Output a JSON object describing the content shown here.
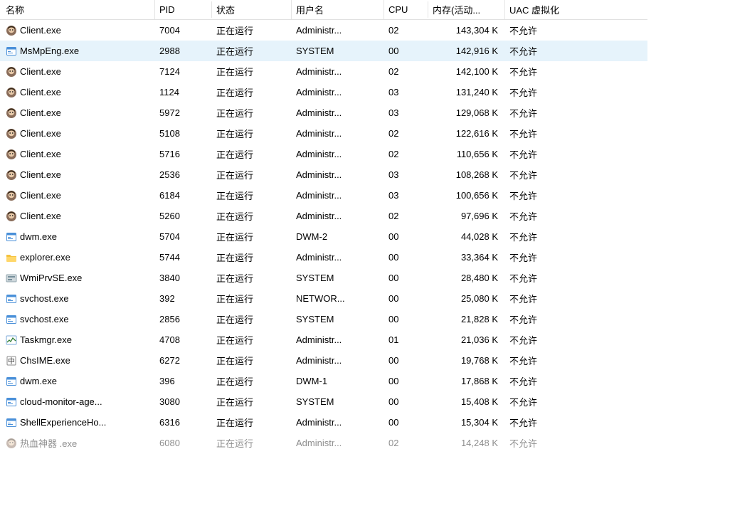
{
  "columns": {
    "name": "名称",
    "pid": "PID",
    "status": "状态",
    "user": "用户名",
    "cpu": "CPU",
    "memory": "内存(活动...",
    "uac": "UAC 虚拟化"
  },
  "status_running": "正在运行",
  "uac_not_allowed": "不允许",
  "rows": [
    {
      "icon": "client",
      "name": "Client.exe",
      "pid": "7004",
      "user": "Administr...",
      "cpu": "02",
      "mem": "143,304 K",
      "selected": false
    },
    {
      "icon": "generic",
      "name": "MsMpEng.exe",
      "pid": "2988",
      "user": "SYSTEM",
      "cpu": "00",
      "mem": "142,916 K",
      "selected": true
    },
    {
      "icon": "client",
      "name": "Client.exe",
      "pid": "7124",
      "user": "Administr...",
      "cpu": "02",
      "mem": "142,100 K",
      "selected": false
    },
    {
      "icon": "client",
      "name": "Client.exe",
      "pid": "1124",
      "user": "Administr...",
      "cpu": "03",
      "mem": "131,240 K",
      "selected": false
    },
    {
      "icon": "client",
      "name": "Client.exe",
      "pid": "5972",
      "user": "Administr...",
      "cpu": "03",
      "mem": "129,068 K",
      "selected": false
    },
    {
      "icon": "client",
      "name": "Client.exe",
      "pid": "5108",
      "user": "Administr...",
      "cpu": "02",
      "mem": "122,616 K",
      "selected": false
    },
    {
      "icon": "client",
      "name": "Client.exe",
      "pid": "5716",
      "user": "Administr...",
      "cpu": "02",
      "mem": "110,656 K",
      "selected": false
    },
    {
      "icon": "client",
      "name": "Client.exe",
      "pid": "2536",
      "user": "Administr...",
      "cpu": "03",
      "mem": "108,268 K",
      "selected": false
    },
    {
      "icon": "client",
      "name": "Client.exe",
      "pid": "6184",
      "user": "Administr...",
      "cpu": "03",
      "mem": "100,656 K",
      "selected": false
    },
    {
      "icon": "client",
      "name": "Client.exe",
      "pid": "5260",
      "user": "Administr...",
      "cpu": "02",
      "mem": "97,696 K",
      "selected": false
    },
    {
      "icon": "generic",
      "name": "dwm.exe",
      "pid": "5704",
      "user": "DWM-2",
      "cpu": "00",
      "mem": "44,028 K",
      "selected": false
    },
    {
      "icon": "folder",
      "name": "explorer.exe",
      "pid": "5744",
      "user": "Administr...",
      "cpu": "00",
      "mem": "33,364 K",
      "selected": false
    },
    {
      "icon": "wmi",
      "name": "WmiPrvSE.exe",
      "pid": "3840",
      "user": "SYSTEM",
      "cpu": "00",
      "mem": "28,480 K",
      "selected": false
    },
    {
      "icon": "generic",
      "name": "svchost.exe",
      "pid": "392",
      "user": "NETWOR...",
      "cpu": "00",
      "mem": "25,080 K",
      "selected": false
    },
    {
      "icon": "generic",
      "name": "svchost.exe",
      "pid": "2856",
      "user": "SYSTEM",
      "cpu": "00",
      "mem": "21,828 K",
      "selected": false
    },
    {
      "icon": "taskmgr",
      "name": "Taskmgr.exe",
      "pid": "4708",
      "user": "Administr...",
      "cpu": "01",
      "mem": "21,036 K",
      "selected": false
    },
    {
      "icon": "ime",
      "name": "ChsIME.exe",
      "pid": "6272",
      "user": "Administr...",
      "cpu": "00",
      "mem": "19,768 K",
      "selected": false
    },
    {
      "icon": "generic",
      "name": "dwm.exe",
      "pid": "396",
      "user": "DWM-1",
      "cpu": "00",
      "mem": "17,868 K",
      "selected": false
    },
    {
      "icon": "generic",
      "name": "cloud-monitor-age...",
      "pid": "3080",
      "user": "SYSTEM",
      "cpu": "00",
      "mem": "15,408 K",
      "selected": false
    },
    {
      "icon": "generic",
      "name": "ShellExperienceHo...",
      "pid": "6316",
      "user": "Administr...",
      "cpu": "00",
      "mem": "15,304 K",
      "selected": false
    }
  ],
  "partial_row": {
    "icon": "client",
    "name": "热血神器 .exe",
    "pid": "6080",
    "user": "Administr...",
    "cpu": "02",
    "mem": "14,248 K"
  }
}
